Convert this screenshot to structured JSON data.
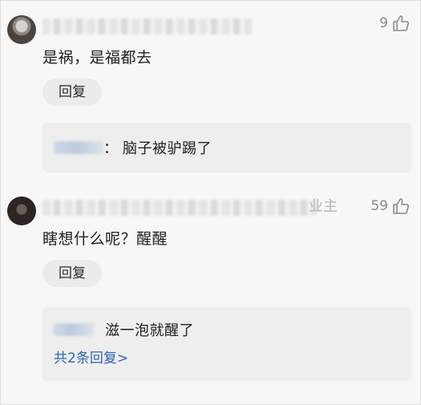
{
  "comments": [
    {
      "likes": "9",
      "text": "是祸，是福都去",
      "reply_button": "回复",
      "reply": {
        "separator": "：",
        "text": "脑子被驴踢了"
      }
    },
    {
      "author_tag": "业主",
      "likes": "59",
      "text": "瞎想什么呢？醒醒",
      "reply_button": "回复",
      "reply": {
        "text": "滋一泡就醒了"
      },
      "view_more": "共2条回复>"
    }
  ],
  "icons": {
    "like": "thumbs-up-outline-icon",
    "avatar": "user-avatar"
  },
  "colors": {
    "background": "#f7f7f7",
    "reply_box": "#eeeeee",
    "link": "#2d63b5",
    "muted": "#8a8a8a"
  }
}
